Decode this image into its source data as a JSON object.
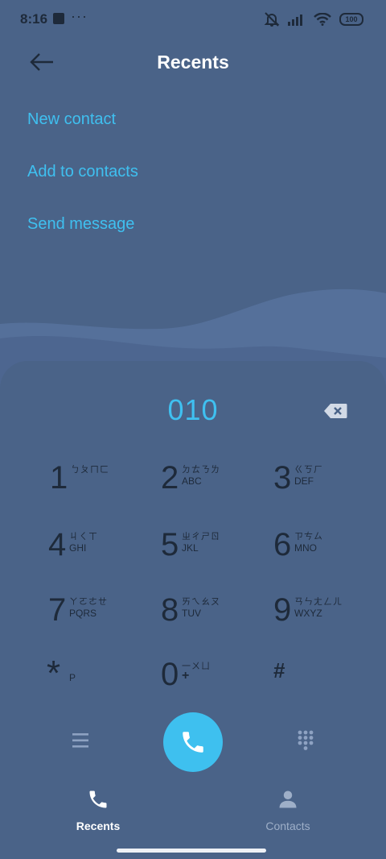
{
  "status_bar": {
    "time": "8:16",
    "notification_dots": "···",
    "battery": "100",
    "icons": [
      "app-notification-icon",
      "muted-bell-icon",
      "signal-icon",
      "wifi-icon",
      "battery-icon"
    ]
  },
  "header": {
    "title": "Recents",
    "back_icon": "arrow-left-icon"
  },
  "actions": [
    {
      "label": "New contact"
    },
    {
      "label": "Add to contacts"
    },
    {
      "label": "Send message"
    }
  ],
  "dialer": {
    "number": "010",
    "backspace_icon": "backspace-icon",
    "keys": [
      {
        "digit": "1",
        "top": "ㄅㄆㄇㄈ",
        "bottom": ""
      },
      {
        "digit": "2",
        "top": "ㄉㄊㄋㄌ",
        "bottom": "ABC"
      },
      {
        "digit": "3",
        "top": "ㄍㄎㄏ",
        "bottom": "DEF"
      },
      {
        "digit": "4",
        "top": "ㄐㄑㄒ",
        "bottom": "GHI"
      },
      {
        "digit": "5",
        "top": "ㄓㄔㄕㄖ",
        "bottom": "JKL"
      },
      {
        "digit": "6",
        "top": "ㄗㄘㄙ",
        "bottom": "MNO"
      },
      {
        "digit": "7",
        "top": "ㄚㄛㄜㄝ",
        "bottom": "PQRS"
      },
      {
        "digit": "8",
        "top": "ㄞㄟㄠㄡ",
        "bottom": "TUV"
      },
      {
        "digit": "9",
        "top": "ㄢㄣㄤㄥㄦ",
        "bottom": "WXYZ"
      },
      {
        "digit": "*",
        "top": "",
        "bottom": "P"
      },
      {
        "digit": "0",
        "top": "一ㄨㄩ",
        "bottom": "+"
      },
      {
        "digit": "#",
        "top": "",
        "bottom": ""
      }
    ],
    "menu_icon": "menu-icon",
    "call_icon": "phone-icon",
    "keypad_icon": "keypad-icon"
  },
  "bottom_nav": {
    "tabs": [
      {
        "label": "Recents",
        "icon": "phone-icon",
        "active": true
      },
      {
        "label": "Contacts",
        "icon": "person-icon",
        "active": false
      }
    ]
  },
  "colors": {
    "background": "#4a6388",
    "accent": "#3fc0f0",
    "dark_text": "#1e2a3a"
  }
}
